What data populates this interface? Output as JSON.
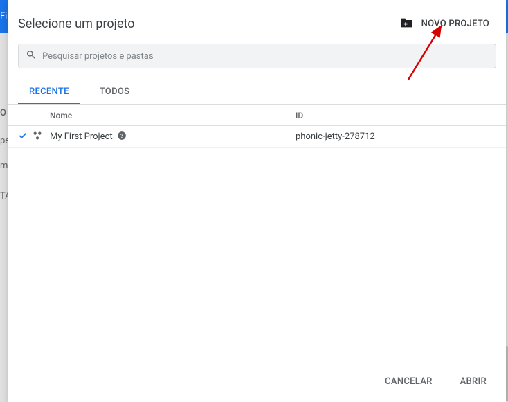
{
  "dialog": {
    "title": "Selecione um projeto",
    "new_project_label": "NOVO PROJETO"
  },
  "search": {
    "placeholder": "Pesquisar projetos e pastas",
    "value": ""
  },
  "tabs": {
    "recent": "RECENTE",
    "all": "TODOS",
    "active": "recent"
  },
  "table": {
    "headers": {
      "name": "Nome",
      "id": "ID"
    },
    "rows": [
      {
        "name": "My First Project",
        "id": "phonic-jetty-278712",
        "selected": true
      }
    ]
  },
  "footer": {
    "cancel": "CANCELAR",
    "open": "ABRIR"
  },
  "background_fragments": {
    "fi": "Fi",
    "o": "O",
    "pe": "pe",
    "m": "m",
    "ta": "TA"
  }
}
